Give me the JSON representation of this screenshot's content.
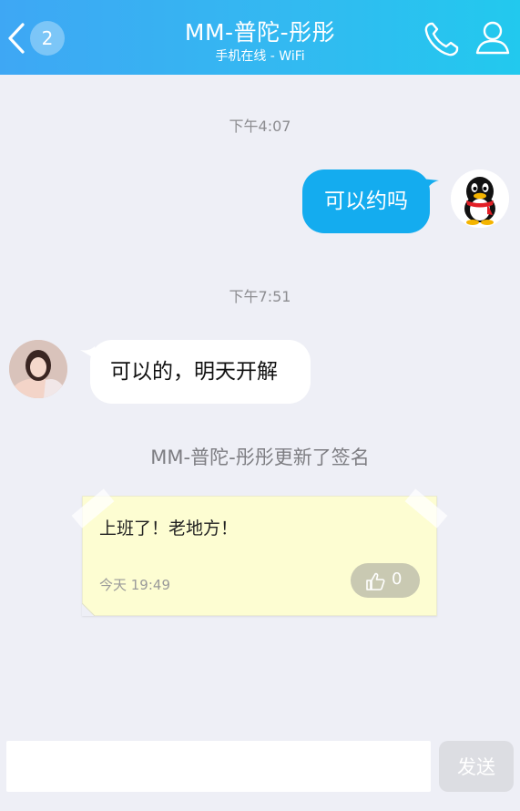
{
  "header": {
    "back_badge": "2",
    "title": "MM-普陀-彤彤",
    "subtitle": "手机在线 - WiFi",
    "icons": [
      "back-chevron-icon",
      "phone-icon",
      "person-icon"
    ],
    "background_colors": [
      "#3ea7f4",
      "#22c9ee"
    ]
  },
  "messages": [
    {
      "time": "下午4:07",
      "direction": "outgoing",
      "text": "可以约吗",
      "color": "#14acef"
    },
    {
      "time": "下午7:51",
      "direction": "incoming",
      "text": "可以的，明天开解",
      "color": "#ffffff"
    }
  ],
  "signature": {
    "notice": "MM-普陀-彤彤更新了签名",
    "text": "上班了！老地方！",
    "time": "今天 19:49",
    "likes": "0",
    "note_color": "#fdfdd2"
  },
  "composer": {
    "input_value": "",
    "send_label": "发送"
  }
}
